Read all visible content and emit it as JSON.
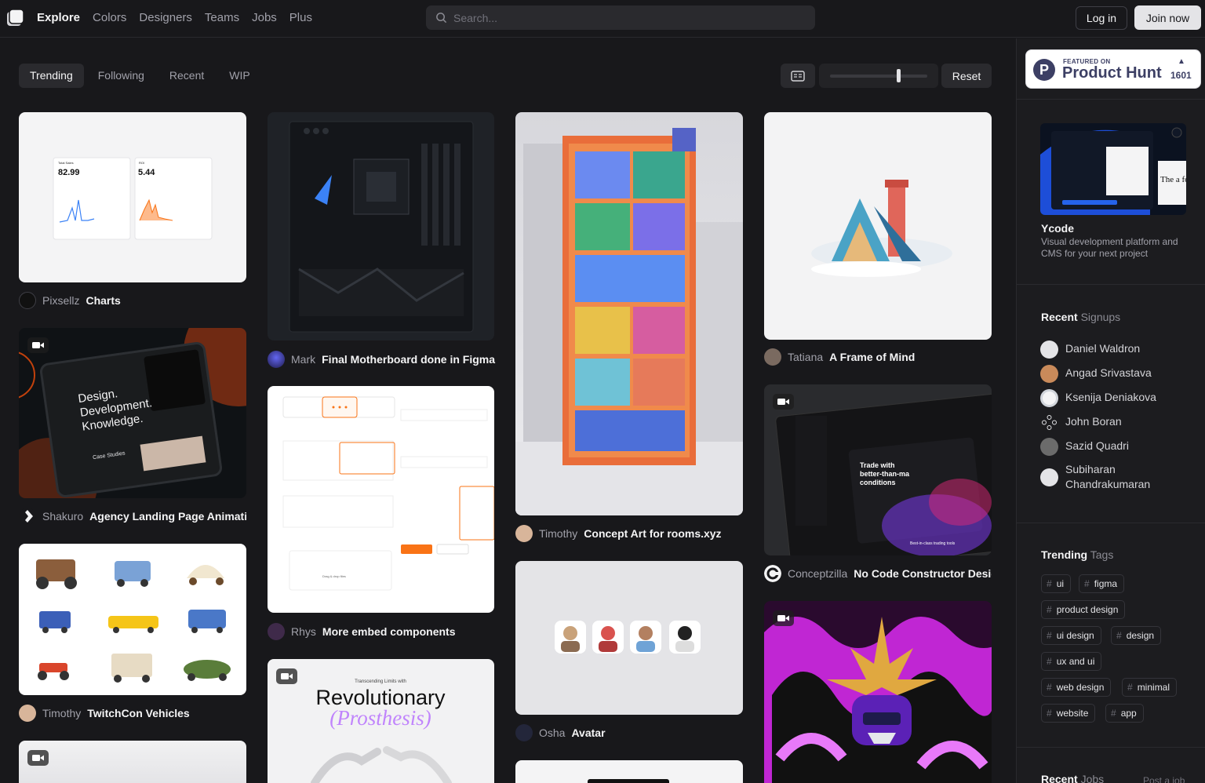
{
  "nav": {
    "links": [
      "Explore",
      "Colors",
      "Designers",
      "Teams",
      "Jobs",
      "Plus"
    ],
    "search_placeholder": "Search...",
    "login": "Log in",
    "join": "Join now"
  },
  "filters": {
    "tabs": [
      "Trending",
      "Following",
      "Recent",
      "WIP"
    ],
    "reset": "Reset"
  },
  "shots": [
    {
      "author": "Pixsellz",
      "title": "Charts",
      "video": false
    },
    {
      "author": "Shakuro",
      "title": "Agency Landing Page Animatic",
      "video": true
    },
    {
      "author": "Timothy",
      "title": "TwitchCon Vehicles",
      "video": false
    },
    {
      "author": "Mark",
      "title": "Final Motherboard done in Figma",
      "video": false
    },
    {
      "author": "Rhys",
      "title": "More embed components",
      "video": false
    },
    {
      "author": "Timothy",
      "title": "Concept Art for rooms.xyz",
      "video": false
    },
    {
      "author": "Osha",
      "title": "Avatar",
      "video": false
    },
    {
      "author": "Tatiana",
      "title": "A Frame of Mind",
      "video": false
    },
    {
      "author": "Conceptzilla",
      "title": "No Code Constructor Design",
      "video": true
    }
  ],
  "shot_text": {
    "charts": {
      "total_sales": "Total Sales",
      "total_value": "82.99",
      "roi": "ROI",
      "roi_value": "5.44"
    },
    "shakuro": {
      "line1": "Design.",
      "line2": "Development.",
      "line3": "Knowledge.",
      "case": "Case Studies"
    },
    "prosthesis": {
      "kicker": "Transcending Limits with",
      "line1": "Revolutionary",
      "line2": "(Prosthesis)"
    },
    "trade": {
      "line1": "Trade with",
      "line2": "better-than-ma",
      "line3": "conditions",
      "footer": "Best-in-class trading tools"
    }
  },
  "sidebar": {
    "product_hunt": {
      "featured": "FEATURED ON",
      "name": "Product Hunt",
      "votes": "1601"
    },
    "ad": {
      "title": "Ycode",
      "description": "Visual development platform and CMS for your next project",
      "img_text": "The a fo"
    },
    "signups_heading": {
      "bold": "Recent",
      "rest": "Signups"
    },
    "signups": [
      "Daniel Waldron",
      "Angad Srivastava",
      "Ksenija Deniakova",
      "John Boran",
      "Sazid Quadri",
      "Subiharan Chandrakumaran"
    ],
    "tags_heading": {
      "bold": "Trending",
      "rest": "Tags"
    },
    "tags": [
      "ui",
      "figma",
      "product design",
      "ui design",
      "design",
      "ux and ui",
      "web design",
      "minimal",
      "website",
      "app"
    ],
    "jobs_heading": {
      "bold": "Recent",
      "rest": "Jobs"
    },
    "post_job": "Post a job"
  },
  "colors": {
    "accent": "#e4e4e7",
    "background": "#18181b",
    "sidebar": "#1c1c1f"
  }
}
